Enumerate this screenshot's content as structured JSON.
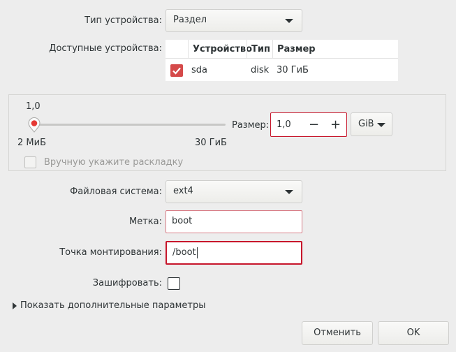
{
  "device_type": {
    "label": "Тип устройства:",
    "value": "Раздел"
  },
  "available_devices": {
    "label": "Доступные устройства:",
    "columns": [
      "Устройство",
      "Тип",
      "Размер"
    ],
    "rows": [
      {
        "checked": true,
        "device": "sda",
        "type": "disk",
        "size": "30 ГиБ"
      }
    ]
  },
  "size_section": {
    "slider_value": "1,0",
    "slider_min": "2 МиБ",
    "slider_max": "30 ГиБ",
    "slider_position": 0.03,
    "size_label": "Размер:",
    "size_value": "1,0",
    "decrement": "−",
    "increment": "+",
    "unit": "GiB",
    "manual_layout_label": "Вручную укажите раскладку"
  },
  "filesystem": {
    "label": "Файловая система:",
    "value": "ext4"
  },
  "label_field": {
    "label": "Метка:",
    "value": "boot"
  },
  "mount_point": {
    "label": "Точка монтирования:",
    "value": "/boot"
  },
  "encrypt": {
    "label": "Зашифровать:",
    "checked": false
  },
  "advanced": {
    "label": "Показать дополнительные параметры"
  },
  "buttons": {
    "cancel": "Отменить",
    "ok": "OK"
  },
  "colors": {
    "accent_red": "#c7162b",
    "checkbox_checked": "#d54a4a",
    "slider_fill": "#e53935"
  }
}
